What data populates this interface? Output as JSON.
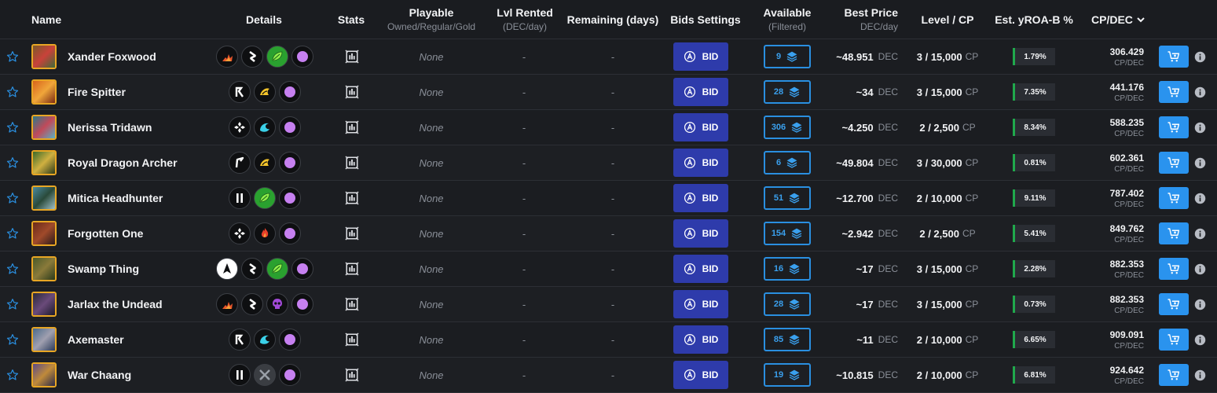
{
  "header": {
    "name": "Name",
    "details": "Details",
    "stats": "Stats",
    "playable": "Playable",
    "playable_sub": "Owned/Regular/Gold",
    "lvl_rented": "Lvl Rented",
    "lvl_rented_sub": "(DEC/day)",
    "remaining": "Remaining (days)",
    "bids_settings": "Bids Settings",
    "available": "Available",
    "available_sub": "(Filtered)",
    "best_price": "Best Price",
    "best_price_sub": "DEC/day",
    "level_cp": "Level / CP",
    "yroa": "Est. yROA-B %",
    "cp_dec": "CP/DEC"
  },
  "labels": {
    "bid": "BID",
    "dec": "DEC",
    "cp": "CP",
    "cp_per_dec": "CP/DEC"
  },
  "colors": {
    "accent_blue": "#2a93ee",
    "bid_button": "#2e3bab",
    "yroa_green": "#20a94c",
    "card_border": "#e8a624"
  },
  "rows": [
    {
      "name": "Xander Foxwood",
      "abilities": [
        "explosion-icon",
        "zigzag-icon",
        "leaf-icon",
        "purple-orb-icon"
      ],
      "playable": "None",
      "lvl_rented": "-",
      "remaining": "-",
      "available": "9",
      "price": "~48.951",
      "level": "3 / 15,000",
      "yroa": "1.79%",
      "cp_dec": "306.429",
      "art": [
        "#7a5a2a",
        "#c9423a",
        "#3e6b3a"
      ]
    },
    {
      "name": "Fire Spitter",
      "abilities": [
        "retaliate-icon",
        "claw-icon",
        "purple-orb-icon"
      ],
      "playable": "None",
      "lvl_rented": "-",
      "remaining": "-",
      "available": "28",
      "price": "~34",
      "level": "3 / 15,000",
      "yroa": "7.35%",
      "cp_dec": "441.176",
      "art": [
        "#d8641c",
        "#f0a63a",
        "#7a2a14"
      ]
    },
    {
      "name": "Nerissa Tridawn",
      "abilities": [
        "diamond-cross-icon",
        "wave-icon",
        "purple-orb-icon"
      ],
      "playable": "None",
      "lvl_rented": "-",
      "remaining": "-",
      "available": "306",
      "price": "~4.250",
      "level": "2 / 2,500",
      "yroa": "8.34%",
      "cp_dec": "588.235",
      "art": [
        "#2a7a8a",
        "#c14a5a",
        "#5ab0c4"
      ]
    },
    {
      "name": "Royal Dragon Archer",
      "abilities": [
        "flag-icon",
        "claw-icon",
        "purple-orb-icon"
      ],
      "playable": "None",
      "lvl_rented": "-",
      "remaining": "-",
      "available": "6",
      "price": "~49.804",
      "level": "3 / 30,000",
      "yroa": "0.81%",
      "cp_dec": "602.361",
      "art": [
        "#3a6a2a",
        "#d0b040",
        "#2a3a1a"
      ]
    },
    {
      "name": "Mitica Headhunter",
      "abilities": [
        "pause-icon",
        "leaf-icon",
        "purple-orb-icon"
      ],
      "playable": "None",
      "lvl_rented": "-",
      "remaining": "-",
      "available": "51",
      "price": "~12.700",
      "level": "2 / 10,000",
      "yroa": "9.11%",
      "cp_dec": "787.402",
      "art": [
        "#4a8aa0",
        "#2a4a3a",
        "#a0c0c8"
      ]
    },
    {
      "name": "Forgotten One",
      "abilities": [
        "diamond-cross-icon",
        "flame-icon",
        "purple-orb-icon"
      ],
      "playable": "None",
      "lvl_rented": "-",
      "remaining": "-",
      "available": "154",
      "price": "~2.942",
      "level": "2 / 2,500",
      "yroa": "5.41%",
      "cp_dec": "849.762",
      "art": [
        "#6a2a1a",
        "#a04a2a",
        "#2a1a1a"
      ]
    },
    {
      "name": "Swamp Thing",
      "abilities": [
        "arrow-up-icon",
        "zigzag-icon",
        "leaf-icon",
        "purple-orb-icon"
      ],
      "playable": "None",
      "lvl_rented": "-",
      "remaining": "-",
      "available": "16",
      "price": "~17",
      "level": "3 / 15,000",
      "yroa": "2.28%",
      "cp_dec": "882.353",
      "art": [
        "#4a5a2a",
        "#8a7a3a",
        "#2a3a1a"
      ]
    },
    {
      "name": "Jarlax the Undead",
      "abilities": [
        "explosion-icon",
        "zigzag-icon",
        "skull-icon",
        "purple-orb-icon"
      ],
      "playable": "None",
      "lvl_rented": "-",
      "remaining": "-",
      "available": "28",
      "price": "~17",
      "level": "3 / 15,000",
      "yroa": "0.73%",
      "cp_dec": "882.353",
      "art": [
        "#2a2a3a",
        "#6a4a7a",
        "#1a1a2a"
      ]
    },
    {
      "name": "Axemaster",
      "abilities": [
        "retaliate-icon",
        "wave-icon",
        "purple-orb-icon"
      ],
      "playable": "None",
      "lvl_rented": "-",
      "remaining": "-",
      "available": "85",
      "price": "~11",
      "level": "2 / 10,000",
      "yroa": "6.65%",
      "cp_dec": "909.091",
      "art": [
        "#4a6a8a",
        "#a0a0b0",
        "#2a3a5a"
      ]
    },
    {
      "name": "War Chaang",
      "abilities": [
        "pause-icon",
        "crossed-swords-icon",
        "purple-orb-icon"
      ],
      "playable": "None",
      "lvl_rented": "-",
      "remaining": "-",
      "available": "19",
      "price": "~10.815",
      "level": "2 / 10,000",
      "yroa": "6.81%",
      "cp_dec": "924.642",
      "art": [
        "#5a4a8a",
        "#c08a3a",
        "#2a2a4a"
      ]
    }
  ]
}
